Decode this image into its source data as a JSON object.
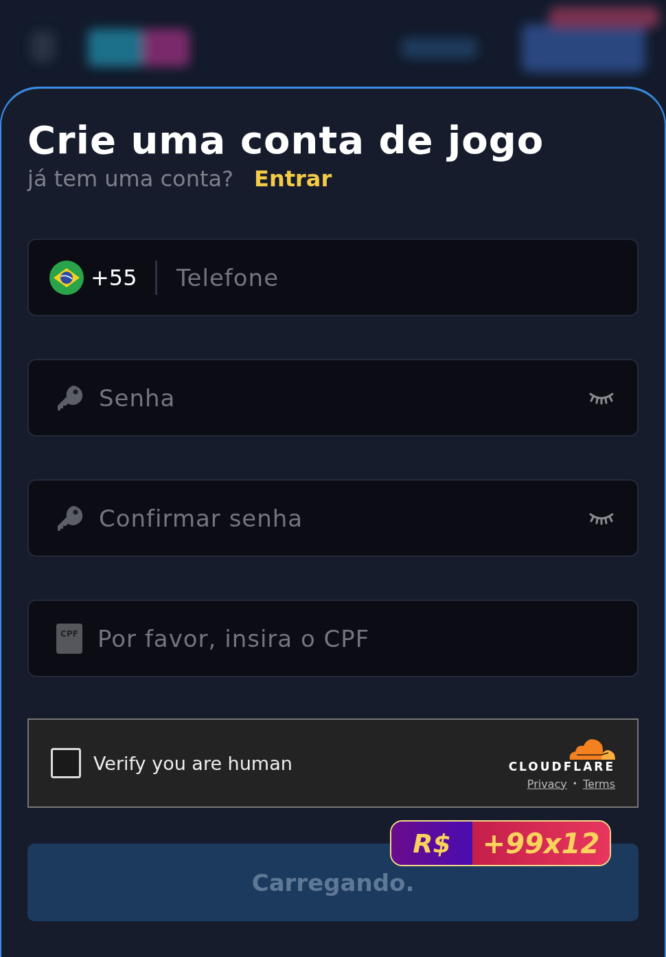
{
  "form": {
    "title": "Crie uma conta de jogo",
    "login_prompt": "já tem uma conta?",
    "login_link": "Entrar"
  },
  "phone_field": {
    "country_code": "+55",
    "placeholder": "Telefone"
  },
  "password_fields": [
    {
      "placeholder": "Senha",
      "visible": false
    },
    {
      "placeholder": "Confirmar senha",
      "visible": false
    }
  ],
  "cpf_field": {
    "icon_text": "CPF",
    "placeholder": "Por favor, insira o CPF"
  },
  "captcha": {
    "label": "Verify you are human",
    "checked": false,
    "brand": "CLOUDFLARE",
    "links": [
      "Privacy",
      "Terms"
    ],
    "separator": "•"
  },
  "submit_button": {
    "label": "Carregando.",
    "disabled": true
  },
  "bonus_badge": {
    "currency": "R$",
    "bonus": "+99x12"
  }
}
